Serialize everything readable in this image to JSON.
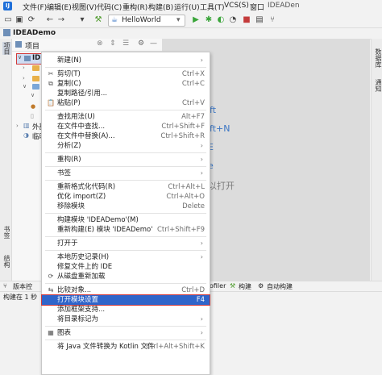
{
  "menubar": {
    "file": "文件(F)",
    "edit": "编辑(E)",
    "view": "视图(V)",
    "code": "代码(C)",
    "refactor": "重构(R)",
    "build": "构建(B)",
    "run": "运行(U)",
    "tools": "工具(T)",
    "vcs": "VCS(S)",
    "window": "窗口",
    "title": "IDEADen"
  },
  "toolbar": {
    "run_config": "HelloWorld"
  },
  "breadcrumb": {
    "project": "IDEADemo"
  },
  "project_panel": {
    "title": "项目",
    "root_label": "IDE",
    "ext_lib": "外部",
    "scratch": "临时"
  },
  "left_stripe": {
    "project": "项目",
    "structure": "结构",
    "bookmarks": "书签"
  },
  "right_stripe": {
    "db": "数据库",
    "notify": "通知"
  },
  "editor_hints": {
    "h1": "ift",
    "h2": "ift+N",
    "h3": "E",
    "h4": "e",
    "h5": "以打开"
  },
  "bottom_tools": {
    "vcs": "版本控",
    "profiler": "ofiler",
    "build": "构建",
    "autobuild": "自动构建"
  },
  "status": {
    "text": "构建在 1 秒"
  },
  "context_menu": [
    {
      "label": "新建(N)",
      "shortcut": "",
      "arrow": true,
      "icon": ""
    },
    {
      "sep": true
    },
    {
      "label": "剪切(T)",
      "shortcut": "Ctrl+X",
      "icon": "✂"
    },
    {
      "label": "复制(C)",
      "shortcut": "Ctrl+C",
      "icon": "⧉"
    },
    {
      "label": "复制路径/引用...",
      "shortcut": "",
      "icon": ""
    },
    {
      "label": "粘贴(P)",
      "shortcut": "Ctrl+V",
      "icon": "📋"
    },
    {
      "sep": true
    },
    {
      "label": "查找用法(U)",
      "shortcut": "Alt+F7",
      "icon": ""
    },
    {
      "label": "在文件中查找...",
      "shortcut": "Ctrl+Shift+F",
      "icon": ""
    },
    {
      "label": "在文件中替换(A)...",
      "shortcut": "Ctrl+Shift+R",
      "icon": ""
    },
    {
      "label": "分析(Z)",
      "shortcut": "",
      "arrow": true,
      "icon": ""
    },
    {
      "sep": true
    },
    {
      "label": "重构(R)",
      "shortcut": "",
      "arrow": true,
      "icon": ""
    },
    {
      "sep": true
    },
    {
      "label": "书签",
      "shortcut": "",
      "arrow": true,
      "icon": ""
    },
    {
      "sep": true
    },
    {
      "label": "重新格式化代码(R)",
      "shortcut": "Ctrl+Alt+L",
      "icon": ""
    },
    {
      "label": "优化 import(Z)",
      "shortcut": "Ctrl+Alt+O",
      "icon": ""
    },
    {
      "label": "移除模块",
      "shortcut": "Delete",
      "icon": ""
    },
    {
      "sep": true
    },
    {
      "label": "构建模块 'IDEADemo'(M)",
      "shortcut": "",
      "icon": ""
    },
    {
      "label": "重新构建(E) 模块 'IDEADemo'",
      "shortcut": "Ctrl+Shift+F9",
      "icon": ""
    },
    {
      "sep": true
    },
    {
      "label": "打开于",
      "shortcut": "",
      "arrow": true,
      "icon": ""
    },
    {
      "sep": true
    },
    {
      "label": "本地历史记录(H)",
      "shortcut": "",
      "arrow": true,
      "icon": ""
    },
    {
      "label": "修复文件上的 IDE",
      "shortcut": "",
      "icon": ""
    },
    {
      "label": "从磁盘重新加载",
      "shortcut": "",
      "icon": "⟳"
    },
    {
      "sep": true
    },
    {
      "label": "比较对象...",
      "shortcut": "Ctrl+D",
      "icon": "⇆"
    },
    {
      "label": "打开模块设置",
      "shortcut": "F4",
      "icon": "",
      "selected": true
    },
    {
      "label": "添加框架支持...",
      "shortcut": "",
      "icon": ""
    },
    {
      "label": "将目录标记为",
      "shortcut": "",
      "arrow": true,
      "icon": ""
    },
    {
      "sep": true
    },
    {
      "label": "图表",
      "shortcut": "",
      "arrow": true,
      "icon": "▦"
    },
    {
      "sep": true
    },
    {
      "label": "将 Java 文件转换为 Kotlin 文件",
      "shortcut": "Ctrl+Alt+Shift+K",
      "icon": ""
    }
  ]
}
